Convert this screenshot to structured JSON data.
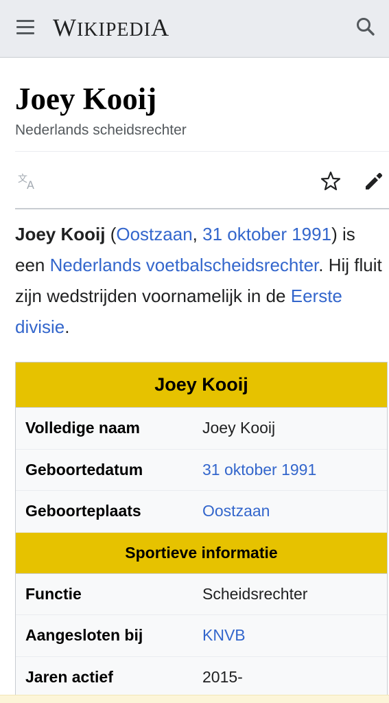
{
  "header": {
    "logo_main": "W",
    "logo_small": "IKIPEDI",
    "logo_end": "A",
    "menu_icon": "hamburger-menu-icon",
    "search_icon": "search-icon"
  },
  "article": {
    "title": "Joey Kooij",
    "description": "Nederlands scheidsrechter",
    "actions": {
      "language_icon": "translate-icon",
      "watch_icon": "star-icon",
      "edit_icon": "pencil-icon"
    },
    "intro": {
      "name_bold": "Joey Kooij",
      "open_paren": " (",
      "place_link": "Oostzaan",
      "comma": ", ",
      "date_link": "31 oktober 1991",
      "close_is": ") is een ",
      "role_link": "Nederlands voetbalscheidsrechter",
      "mid_text": ". Hij fluit zijn wedstrijden voornamelijk in de ",
      "league_link": "Eerste divisie",
      "end": "."
    }
  },
  "infobox": {
    "header": "Joey Kooij",
    "rows_personal": [
      {
        "label": "Volledige naam",
        "value": "Joey Kooij"
      },
      {
        "label": "Geboortedatum",
        "value": "31 oktober 1991"
      },
      {
        "label": "Geboorteplaats",
        "value": "Oostzaan"
      }
    ],
    "section_header": "Sportieve informatie",
    "rows_sport": [
      {
        "label": "Functie",
        "value": "Scheidsrechter"
      },
      {
        "label": "Aangesloten bij",
        "value": "KNVB"
      },
      {
        "label": "Jaren actief",
        "value": "2015-"
      }
    ]
  },
  "colors": {
    "link": "#3366cc",
    "infobox_header": "#e6c200",
    "header_bg": "#eaecf0"
  }
}
